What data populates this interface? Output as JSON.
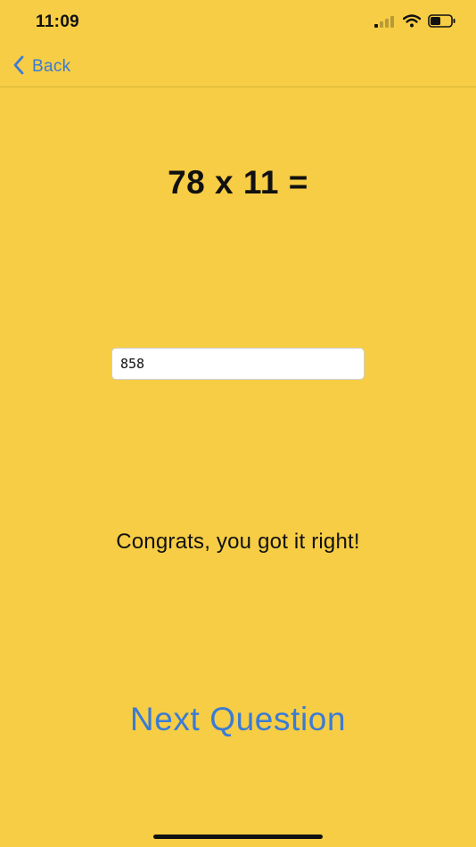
{
  "status_bar": {
    "time": "11:09",
    "icons": [
      "cellular-signal-icon",
      "wifi-icon",
      "battery-icon"
    ],
    "battery_level": 0.5
  },
  "nav": {
    "back_label": "Back",
    "back_icon": "chevron-left-icon"
  },
  "main": {
    "question": "78 x 11 =",
    "answer_value": "858",
    "result_message": "Congrats, you got it right!",
    "next_label": "Next Question"
  },
  "colors": {
    "background": "#f6cd44",
    "accent": "#3a7bd5",
    "text": "#111111"
  }
}
